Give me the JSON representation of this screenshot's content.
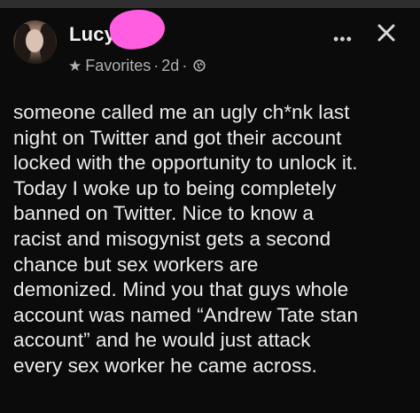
{
  "post": {
    "author": "Lucy",
    "audience": "Favorites",
    "separator": "·",
    "time": "2d",
    "body_lines": [
      "someone called me an ugly ch*nk last",
      "night on Twitter and got their account",
      "locked with the opportunity to unlock it.",
      "Today I woke up to being completely",
      "banned on Twitter. Nice to know a",
      "racist and misogynist gets a second",
      "chance but sex workers are",
      "demonized. Mind you that guys whole",
      "account was named “Andrew Tate stan",
      "account” and he would just attack",
      "every sex worker he came across."
    ]
  },
  "controls": {
    "more_label": "•••"
  },
  "icons": {
    "audience": "star-icon",
    "privacy": "globe-icon",
    "more": "more-options-icon",
    "close": "close-icon"
  },
  "colors": {
    "background": "#0b0b0b",
    "text": "#ececec",
    "meta_text": "#b0b0b0",
    "redaction": "#ff5ee1"
  }
}
